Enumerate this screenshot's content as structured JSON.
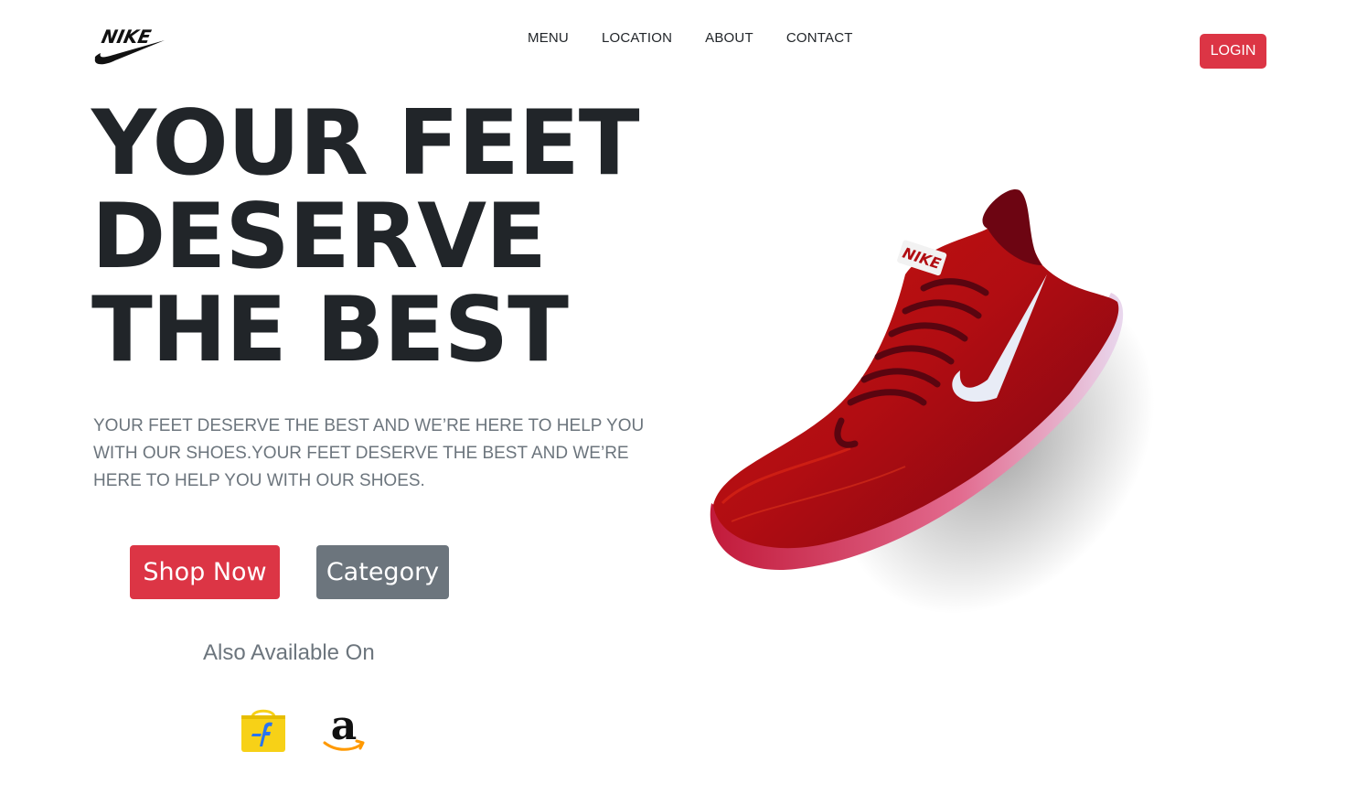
{
  "brand": {
    "logo_icon": "nike-swoosh-logo-icon",
    "logo_text": "NIKE"
  },
  "nav": {
    "items": [
      {
        "label": "MENU"
      },
      {
        "label": "LOCATION"
      },
      {
        "label": "ABOUT"
      },
      {
        "label": "CONTACT"
      }
    ],
    "login_label": "LOGIN"
  },
  "hero": {
    "headline_lines": [
      "YOUR FEET",
      "DESERVE",
      "THE BEST"
    ],
    "description": "YOUR FEET DESERVE THE BEST AND WE’RE HERE TO HELP YOU WITH OUR SHOES.YOUR FEET DESERVE THE BEST AND WE’RE HERE TO HELP YOU WITH OUR SHOES.",
    "shop_button": "Shop Now",
    "category_button": "Category",
    "also_available": "Also Available On",
    "stores": [
      {
        "icon": "flipkart-icon"
      },
      {
        "icon": "amazon-icon"
      }
    ],
    "product_image": "red-running-shoe-image",
    "shoe_brand_text": "NIKE"
  },
  "colors": {
    "accent_red": "#dc3545",
    "secondary_gray": "#6c757d",
    "text_dark": "#212529"
  }
}
